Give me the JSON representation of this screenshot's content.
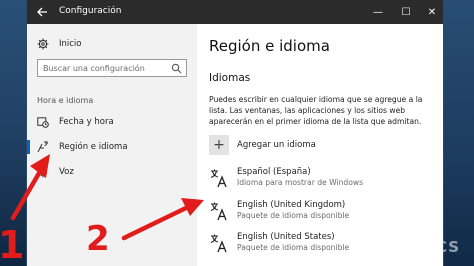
{
  "window": {
    "title": "Configuración",
    "back_icon": "arrow-left-icon",
    "controls": {
      "minimize": "—",
      "maximize": "☐",
      "close": "✕"
    }
  },
  "sidebar": {
    "home": {
      "label": "Inicio",
      "icon": "gear-icon"
    },
    "search": {
      "placeholder": "Buscar una configuración",
      "icon": "search-icon"
    },
    "section_label": "Hora e idioma",
    "items": [
      {
        "label": "Fecha y hora",
        "icon": "calendar-clock-icon",
        "active": false
      },
      {
        "label": "Región e idioma",
        "icon": "region-language-icon",
        "active": true
      },
      {
        "label": "Voz",
        "icon": "microphone-icon",
        "active": false
      }
    ]
  },
  "main": {
    "page_title": "Región e idioma",
    "subheading": "Idiomas",
    "description": "Puedes escribir en cualquier idioma que se agregue a la lista. Las ventanas, las aplicaciones y los sitios web aparecerán en el primer idioma de la lista que admitan.",
    "add_language": {
      "label": "Agregar un idioma",
      "icon": "plus-icon"
    },
    "languages": [
      {
        "name": "Español (España)",
        "detail": "Idioma para mostrar de Windows",
        "icon": "language-icon"
      },
      {
        "name": "English (United Kingdom)",
        "detail": "Paquete de idioma disponible",
        "icon": "language-icon"
      },
      {
        "name": "English (United States)",
        "detail": "Paquete de idioma disponible",
        "icon": "language-icon"
      }
    ]
  },
  "annotations": {
    "marker_1": "1",
    "marker_2": "2",
    "color": "#e21b1b"
  },
  "watermark": "CS",
  "colors": {
    "titlebar": "#2b2b2b",
    "sidebar": "#f2f2f2",
    "accent": "#0a63b8",
    "annotation_red": "#e21b1b"
  }
}
